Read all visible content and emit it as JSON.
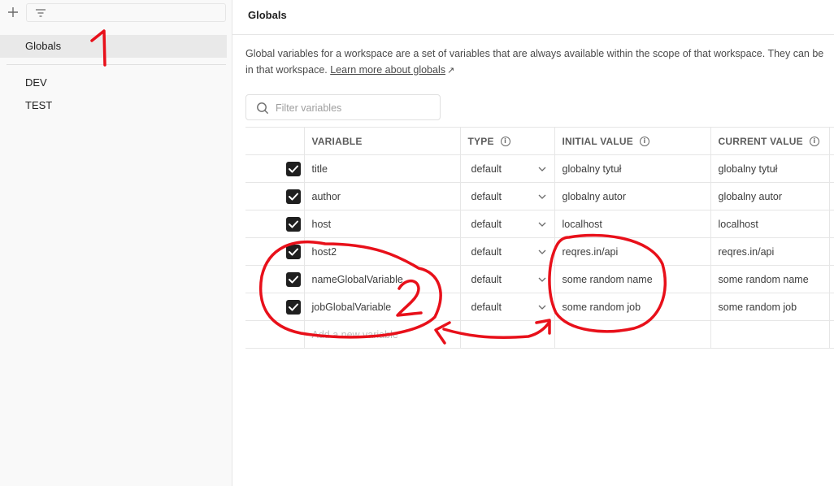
{
  "sidebar": {
    "filter_placeholder": "",
    "items": [
      {
        "label": "Globals",
        "active": true
      },
      {
        "label": "DEV",
        "active": false
      },
      {
        "label": "TEST",
        "active": false
      }
    ]
  },
  "main": {
    "title": "Globals",
    "description_line1": "Global variables for a workspace are a set of variables that are always available within the scope of that workspace. They can be",
    "description_line2": "in that workspace. ",
    "learn_more": "Learn more about globals",
    "learn_more_arrow": "↗",
    "search_placeholder": "Filter variables"
  },
  "table": {
    "headers": {
      "variable": "VARIABLE",
      "type": "TYPE",
      "initial": "INITIAL VALUE",
      "current": "CURRENT VALUE"
    },
    "rows": [
      {
        "enabled": true,
        "variable": "title",
        "type": "default",
        "initial": "globalny tytuł",
        "current": "globalny tytuł"
      },
      {
        "enabled": true,
        "variable": "author",
        "type": "default",
        "initial": "globalny autor",
        "current": "globalny autor"
      },
      {
        "enabled": true,
        "variable": "host",
        "type": "default",
        "initial": "localhost",
        "current": "localhost"
      },
      {
        "enabled": true,
        "variable": "host2",
        "type": "default",
        "initial": "reqres.in/api",
        "current": "reqres.in/api"
      },
      {
        "enabled": true,
        "variable": "nameGlobalVariable",
        "type": "default",
        "initial": "some random name",
        "current": "some random name"
      },
      {
        "enabled": true,
        "variable": "jobGlobalVariable",
        "type": "default",
        "initial": "some random job",
        "current": "some random job"
      }
    ],
    "add_new_placeholder": "Add a new variable"
  },
  "annotations": {
    "marker1": "1",
    "marker2": "2",
    "color": "#e8101a"
  },
  "colors": {
    "sidebar_bg": "#f9f9f9",
    "active_item_bg": "#e9e9e9",
    "checkbox": "#1f1f1f"
  }
}
